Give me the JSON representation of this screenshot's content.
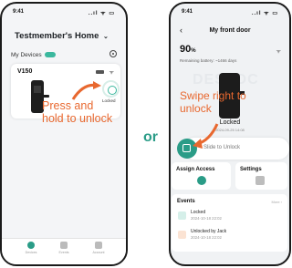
{
  "left_phone": {
    "status_time": "9:41",
    "status_icons": "..ıl ᯤ ▭",
    "title": "Testmember's Home",
    "section_label": "My Devices",
    "device": {
      "name": "V150",
      "state": "Locked"
    },
    "nav": [
      {
        "label": "Devices",
        "active": true
      },
      {
        "label": "Events",
        "active": false
      },
      {
        "label": "Account",
        "active": false
      }
    ]
  },
  "overlay_left": "Press and hold to unlock",
  "separator": "or",
  "right_phone": {
    "status_time": "9:41",
    "status_icons": "..ıl ᯤ ▭",
    "back_glyph": "‹",
    "title": "My front door",
    "battery_value": "90",
    "battery_unit": "%",
    "remaining": "Remaining battery: ~1466 days",
    "watermark": "DESLOC",
    "lock_state": "Locked",
    "lock_timestamp": "2024-09-25 14:08",
    "slide_label": "Slide to Unlock",
    "tiles": [
      {
        "label": "Assign Access"
      },
      {
        "label": "Settings"
      }
    ],
    "events": {
      "title": "Events",
      "more": "More ›",
      "items": [
        {
          "title": "Locked",
          "time": "2024-10-18 22:02"
        },
        {
          "title": "Unlocked by Jack",
          "time": "2024-10-18 22:02"
        }
      ]
    }
  },
  "overlay_right": "Swipe right to unlock",
  "colors": {
    "accent": "#2a9c87",
    "callout": "#e8682f"
  }
}
